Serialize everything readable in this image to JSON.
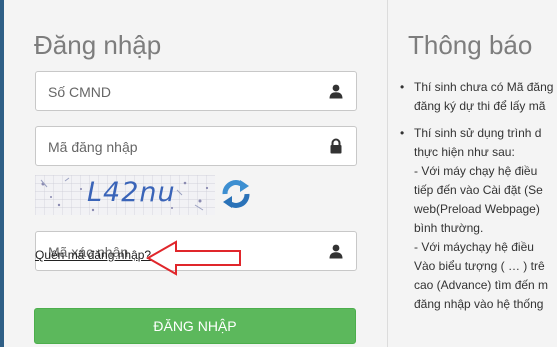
{
  "login": {
    "title": "Đăng nhập",
    "id_placeholder": "Số CMND",
    "code_placeholder": "Mã đăng nhập",
    "captcha_text": "L42nu",
    "verify_placeholder": "Mã xác nhận",
    "forgot_link": "Quên mã đăng nhập?",
    "submit_label": "ĐĂNG NHẬP",
    "accent_color": "#5cb85c",
    "arrow_color": "#e0262b"
  },
  "notice": {
    "title": "Thông báo",
    "items": [
      {
        "lines": [
          "Thí sinh chưa có Mã đăng",
          "đăng ký dự thi để lấy mã"
        ]
      },
      {
        "lines": [
          "Thí sinh sử dụng trình d",
          "thực hiện như sau:",
          " - Với máy chạy hệ điều",
          "tiếp đến vào Cài đặt (Se",
          "web(Preload Webpage)",
          "bình thường.",
          " - Với máychạy hệ điều",
          "Vào biểu tượng ( … ) trê",
          "cao (Advance) tìm đến m",
          "đăng nhập vào hệ thống"
        ]
      }
    ]
  }
}
